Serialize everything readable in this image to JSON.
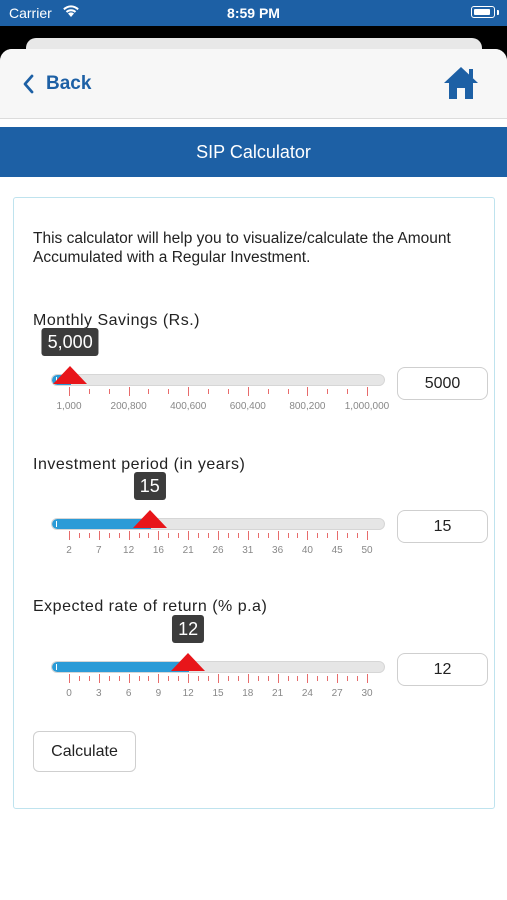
{
  "status_bar": {
    "carrier": "Carrier",
    "time": "8:59 PM"
  },
  "nav": {
    "back_label": "Back"
  },
  "page_title": "SIP Calculator",
  "intro_text": "This calculator will help you to visualize/calculate the Amount Accumulated with a Regular Investment.",
  "sliders": [
    {
      "label": "Monthly Savings (Rs.)",
      "bubble": "5,000",
      "input_value": "5000",
      "min": 1000,
      "max": 1000000,
      "value": 5000,
      "ticks": [
        "1,000",
        "200,800",
        "400,600",
        "600,400",
        "800,200",
        "1,000,000"
      ]
    },
    {
      "label": "Investment period (in years)",
      "bubble": "15",
      "input_value": "15",
      "min": 2,
      "max": 50,
      "value": 15,
      "ticks": [
        "2",
        "7",
        "12",
        "16",
        "21",
        "26",
        "31",
        "36",
        "40",
        "45",
        "50"
      ]
    },
    {
      "label": "Expected rate of return (% p.a)",
      "bubble": "12",
      "input_value": "12",
      "min": 0,
      "max": 30,
      "value": 12,
      "ticks": [
        "0",
        "3",
        "6",
        "9",
        "12",
        "15",
        "18",
        "21",
        "24",
        "27",
        "30"
      ]
    }
  ],
  "calculate_label": "Calculate",
  "colors": {
    "brand_blue": "#1d60a5",
    "slider_fill": "#2b9bd7",
    "thumb_red": "#e8151a",
    "tick_red": "#e76b6b"
  },
  "icons": {
    "back": "chevron-left-icon",
    "home": "home-icon",
    "wifi": "wifi-icon",
    "battery": "battery-icon"
  }
}
